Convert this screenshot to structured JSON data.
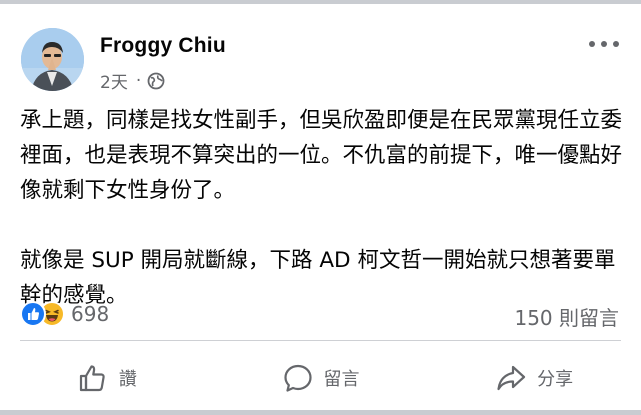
{
  "post": {
    "author": "Froggy Chiu",
    "time": "2天",
    "separator": "·",
    "privacy_icon": "globe-icon",
    "more_icon": "more-options-icon",
    "paragraphs": [
      "承上題，同樣是找女性副手，但吳欣盈即便是在民眾黨現任立委裡面，也是表現不算突出的一位。不仇富的前提下，唯一優點好像就剩下女性身份了。",
      "就像是 SUP 開局就斷線，下路 AD 柯文哲一開始就只想著要單幹的感覺。"
    ]
  },
  "engagement": {
    "reaction_icons": [
      "like-reaction-icon",
      "haha-reaction-icon"
    ],
    "reaction_count": "698",
    "comment_count": "150 則留言"
  },
  "actions": {
    "like_label": "讚",
    "comment_label": "留言",
    "share_label": "分享"
  },
  "colors": {
    "like_blue": "#1877f2",
    "haha_yellow": "#f7b928",
    "secondary_text": "#65676b",
    "background": "#c9ccd1"
  }
}
